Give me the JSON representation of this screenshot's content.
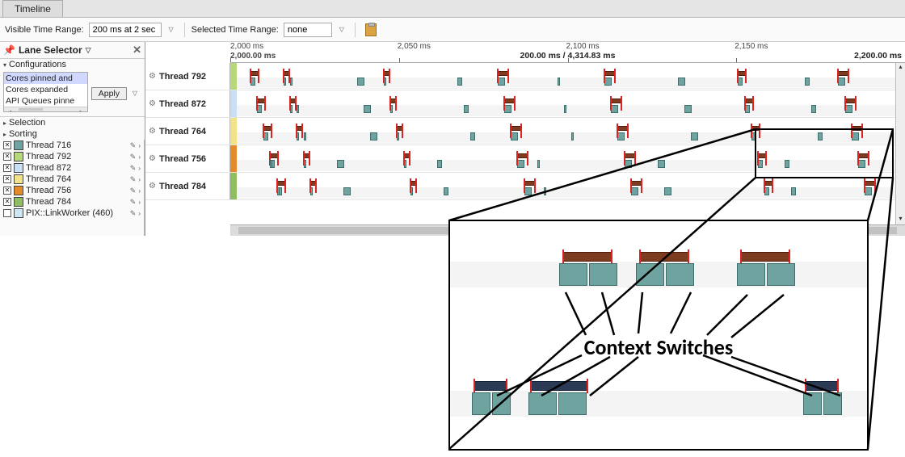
{
  "tab": {
    "title": "Timeline"
  },
  "toolbar": {
    "visible_label": "Visible Time Range:",
    "visible_value": "200 ms at 2 sec",
    "selected_label": "Selected Time Range:",
    "selected_value": "none"
  },
  "side_panel": {
    "title": "Lane Selector",
    "section_configurations": "Configurations",
    "config_options": [
      "Cores pinned and",
      "Cores expanded",
      "API Queues pinne"
    ],
    "apply_label": "Apply",
    "section_selection": "Selection",
    "section_sorting": "Sorting",
    "threads": [
      {
        "id": "Thread 716",
        "color": "#6fa3a0",
        "checked": true
      },
      {
        "id": "Thread 792",
        "color": "#b6d87a",
        "checked": true
      },
      {
        "id": "Thread 872",
        "color": "#c9dff6",
        "checked": true
      },
      {
        "id": "Thread 764",
        "color": "#f2e38a",
        "checked": true
      },
      {
        "id": "Thread 756",
        "color": "#e38a2b",
        "checked": true
      },
      {
        "id": "Thread 784",
        "color": "#8fbd62",
        "checked": true
      },
      {
        "id": "PIX::LinkWorker (460)",
        "color": "#cfe5f3",
        "checked": false
      }
    ]
  },
  "ruler": {
    "ticks": [
      {
        "pos": 0,
        "label": "2,000 ms",
        "bold": false
      },
      {
        "pos": 0,
        "label": "2,000.00 ms",
        "bold": true,
        "below": true
      },
      {
        "pos": 25,
        "label": "2,050 ms",
        "bold": false
      },
      {
        "pos": 50,
        "label": "2,100 ms",
        "bold": false
      },
      {
        "pos": 75,
        "label": "2,150 ms",
        "bold": false
      }
    ],
    "center_text": "200.00 ms / 4,314.83 ms",
    "end_label": "2,200.00 ms"
  },
  "tracks": [
    {
      "name": "Thread 792",
      "color": "#b6d87a"
    },
    {
      "name": "Thread 872",
      "color": "#c9dff6"
    },
    {
      "name": "Thread 764",
      "color": "#f2e38a"
    },
    {
      "name": "Thread 756",
      "color": "#e38a2b"
    },
    {
      "name": "Thread 784",
      "color": "#8fbd62"
    }
  ],
  "callout": {
    "label": "Context Switches"
  }
}
